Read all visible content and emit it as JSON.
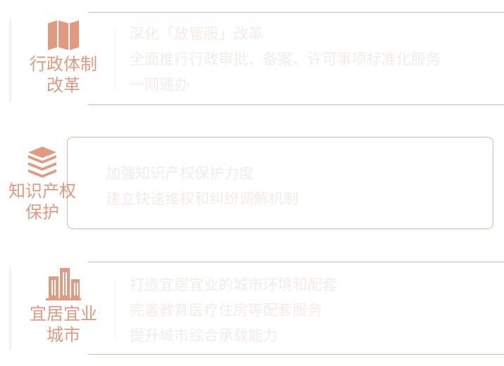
{
  "colors": {
    "accent": "#df9a80",
    "border": "#e7b6a3",
    "faint_text": "#f5ece7"
  },
  "sections": [
    {
      "icon": "folded-map-icon",
      "label": "行政体制\n改革",
      "content": "深化「放管服」改革\n全面推行行政审批、备案、许可事项标准化服务\n一网通办"
    },
    {
      "icon": "book-stack-icon",
      "label": "知识产权\n保护",
      "content": "加强知识产权保护力度\n建立快速维权和纠纷调解机制"
    },
    {
      "icon": "city-buildings-icon",
      "label": "宜居宜业\n城市",
      "content": "打造宜居宜业的城市环境和配套\n完善教育医疗住房等配套服务\n提升城市综合承载能力"
    }
  ]
}
